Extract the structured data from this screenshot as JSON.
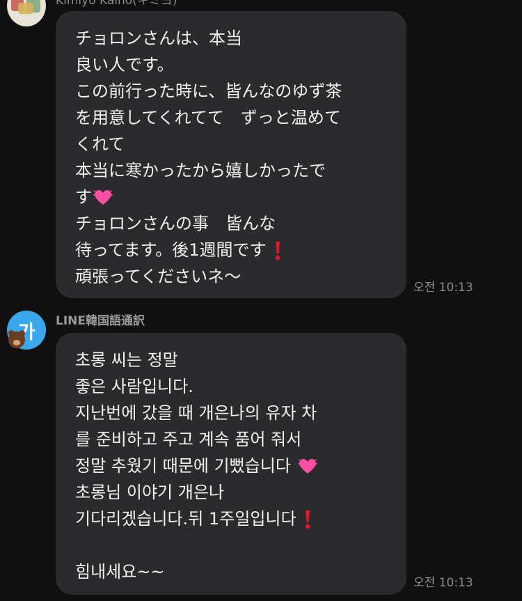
{
  "messages": [
    {
      "sender": "Kimiyo Kaino(キミヨ)",
      "time": "오전 10:13",
      "lines": [
        "チョロンさんは、本当",
        "良い人です。",
        "この前行った時に、皆んなのゆず茶",
        "を用意してくれてて　ずっと温めて",
        "くれて",
        "本当に寒かったから嬉しかったで",
        "す",
        "チョロンさんの事　皆んな",
        "待ってます。後1週間です",
        "頑張ってくださいネ～"
      ]
    },
    {
      "sender": "LINE韓国語通訳",
      "avatar_text": "가",
      "time": "오전 10:13",
      "lines": [
        "초롱 씨는 정말",
        "좋은 사람입니다.",
        "지난번에 갔을 때 개은나의 유자 차",
        "를 준비하고 주고 계속 품어 줘서",
        "정말 추웠기 때문에 기뻤습니다",
        "초롱님 이야기 개은나",
        "기다리겠습니다.뒤 1주일입니다",
        "",
        "힘내세요~~"
      ]
    }
  ],
  "colors": {
    "background": "#101010",
    "bubble": "#2b2b2d",
    "avatar_blue": "#3aa7ea",
    "heart": "#ff4fa3",
    "exclamation": "#e0162b"
  }
}
